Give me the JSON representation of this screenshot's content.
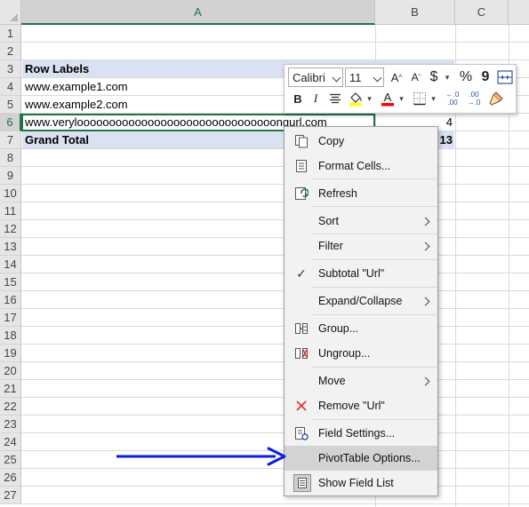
{
  "sheet": {
    "columns": [
      "A",
      "B",
      "C"
    ],
    "rows": [
      "1",
      "2",
      "3",
      "4",
      "5",
      "6",
      "7",
      "8",
      "9",
      "10",
      "11",
      "12",
      "13",
      "14",
      "15",
      "16",
      "17",
      "18",
      "19",
      "20",
      "21",
      "22",
      "23",
      "24",
      "25",
      "26",
      "27"
    ],
    "active_column": "A",
    "active_row": "6"
  },
  "pivot": {
    "header_label": "Row Labels",
    "items": [
      "www.example1.com",
      "www.example2.com",
      "www.verylooooooooooooooooooooooooooooooongurl.com"
    ],
    "item3_value": "4",
    "grand_total_label": "Grand Total",
    "grand_total_value": "13"
  },
  "mini_toolbar": {
    "font_name": "Calibri",
    "font_size": "11",
    "grow_font": "A",
    "shrink_font": "A",
    "currency": "$",
    "percent": "%",
    "comma": "9",
    "bold": "B",
    "italic": "I",
    "font_color_letter": "A",
    "fill_color": "#ffff00",
    "font_color": "#ff0000",
    "increase_decimal_top": "←.0",
    "increase_decimal_bottom": ".00",
    "decrease_decimal_top": ".00",
    "decrease_decimal_bottom": "→.0"
  },
  "context_menu": {
    "items": [
      {
        "label": "Copy"
      },
      {
        "label": "Format Cells..."
      },
      {
        "label": "Refresh"
      },
      {
        "label": "Sort"
      },
      {
        "label": "Filter"
      },
      {
        "label": "Subtotal \"Url\""
      },
      {
        "label": "Expand/Collapse"
      },
      {
        "label": "Group..."
      },
      {
        "label": "Ungroup..."
      },
      {
        "label": "Move"
      },
      {
        "label": "Remove \"Url\""
      },
      {
        "label": "Field Settings..."
      },
      {
        "label": "PivotTable Options..."
      },
      {
        "label": "Show Field List"
      }
    ]
  },
  "colors": {
    "excel_green": "#217346",
    "pivot_band": "#d9e1f2",
    "arrow_blue": "#0a1ee6",
    "menu_bg": "#f2f2f2",
    "menu_highlight": "#d3d3d3"
  }
}
